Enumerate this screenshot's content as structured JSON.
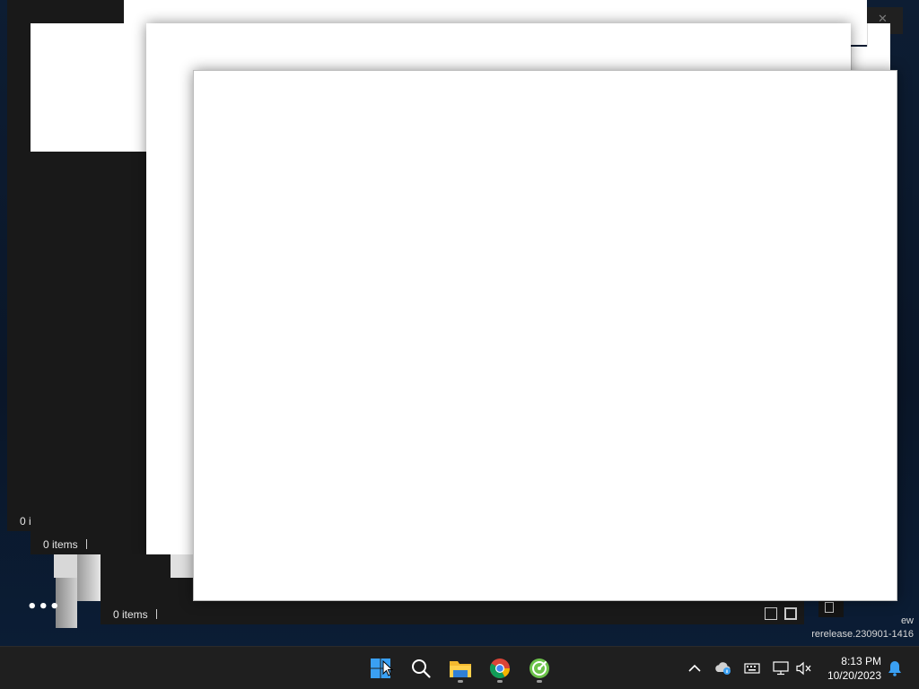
{
  "windows": {
    "status_a": "0 i",
    "status_b": "0 items",
    "status_c": "0 items",
    "watermark_line1": "ew",
    "watermark_line2": "rerelease.230901-1416"
  },
  "taskbar": {
    "apps": [
      {
        "name": "Start",
        "icon": "windows-start-icon"
      },
      {
        "name": "Search",
        "icon": "search-icon"
      },
      {
        "name": "File Explorer",
        "icon": "folder-icon"
      },
      {
        "name": "Google Chrome",
        "icon": "chrome-icon"
      },
      {
        "name": "App",
        "icon": "green-circle-app-icon"
      }
    ],
    "tray": {
      "chevron": "chevron-up-icon",
      "icons": [
        "onedrive-icon",
        "keyboard-icon",
        "network-icon",
        "volume-muted-icon"
      ]
    },
    "clock": {
      "time": "8:13 PM",
      "date": "10/20/2023"
    },
    "notification": "bell-icon"
  },
  "colors": {
    "taskbar_bg": "#1f1f1f",
    "window_dark": "#191919",
    "window_light": "#ffffff",
    "accent_blue": "#3aa0f3"
  }
}
